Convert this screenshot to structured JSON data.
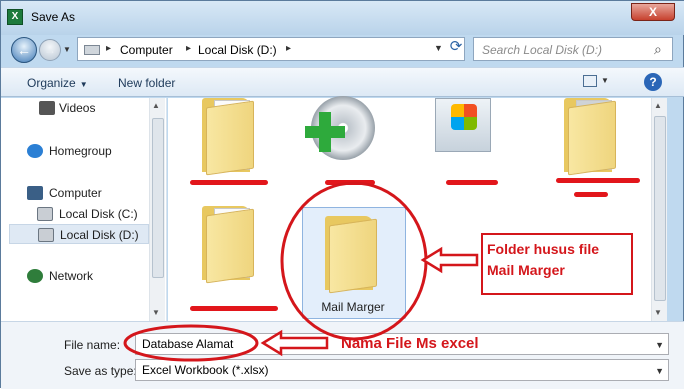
{
  "window": {
    "title": "Save As",
    "close_label": "X"
  },
  "nav": {
    "breadcrumbs": [
      "Computer",
      "Local Disk (D:)"
    ],
    "search_placeholder": "Search Local Disk (D:)"
  },
  "toolbar": {
    "organize_label": "Organize",
    "new_folder_label": "New folder"
  },
  "sidebar": {
    "items": [
      {
        "label": "Videos",
        "icon": "video-icon",
        "selected": false
      },
      {
        "label": "Homegroup",
        "icon": "homegroup-icon",
        "selected": false
      },
      {
        "label": "Computer",
        "icon": "computer-icon",
        "selected": false
      },
      {
        "label": "Local Disk (C:)",
        "icon": "drive-icon",
        "selected": false
      },
      {
        "label": "Local Disk (D:)",
        "icon": "drive-icon",
        "selected": true
      },
      {
        "label": "Network",
        "icon": "network-icon",
        "selected": false
      }
    ]
  },
  "files": [
    {
      "label": "Mail Marger",
      "icon": "folder-icon",
      "selected": true
    }
  ],
  "bottom": {
    "file_name_label": "File name:",
    "file_name_value": "Database Alamat",
    "save_type_label": "Save as type:",
    "save_type_value": "Excel Workbook (*.xlsx)"
  },
  "annotations": {
    "folder_note_line1": "Folder husus file",
    "folder_note_line2": "Mail Marger",
    "filename_note": "Nama File Ms excel"
  },
  "colors": {
    "annotation": "#d4161b",
    "accent": "#2a66b7"
  }
}
